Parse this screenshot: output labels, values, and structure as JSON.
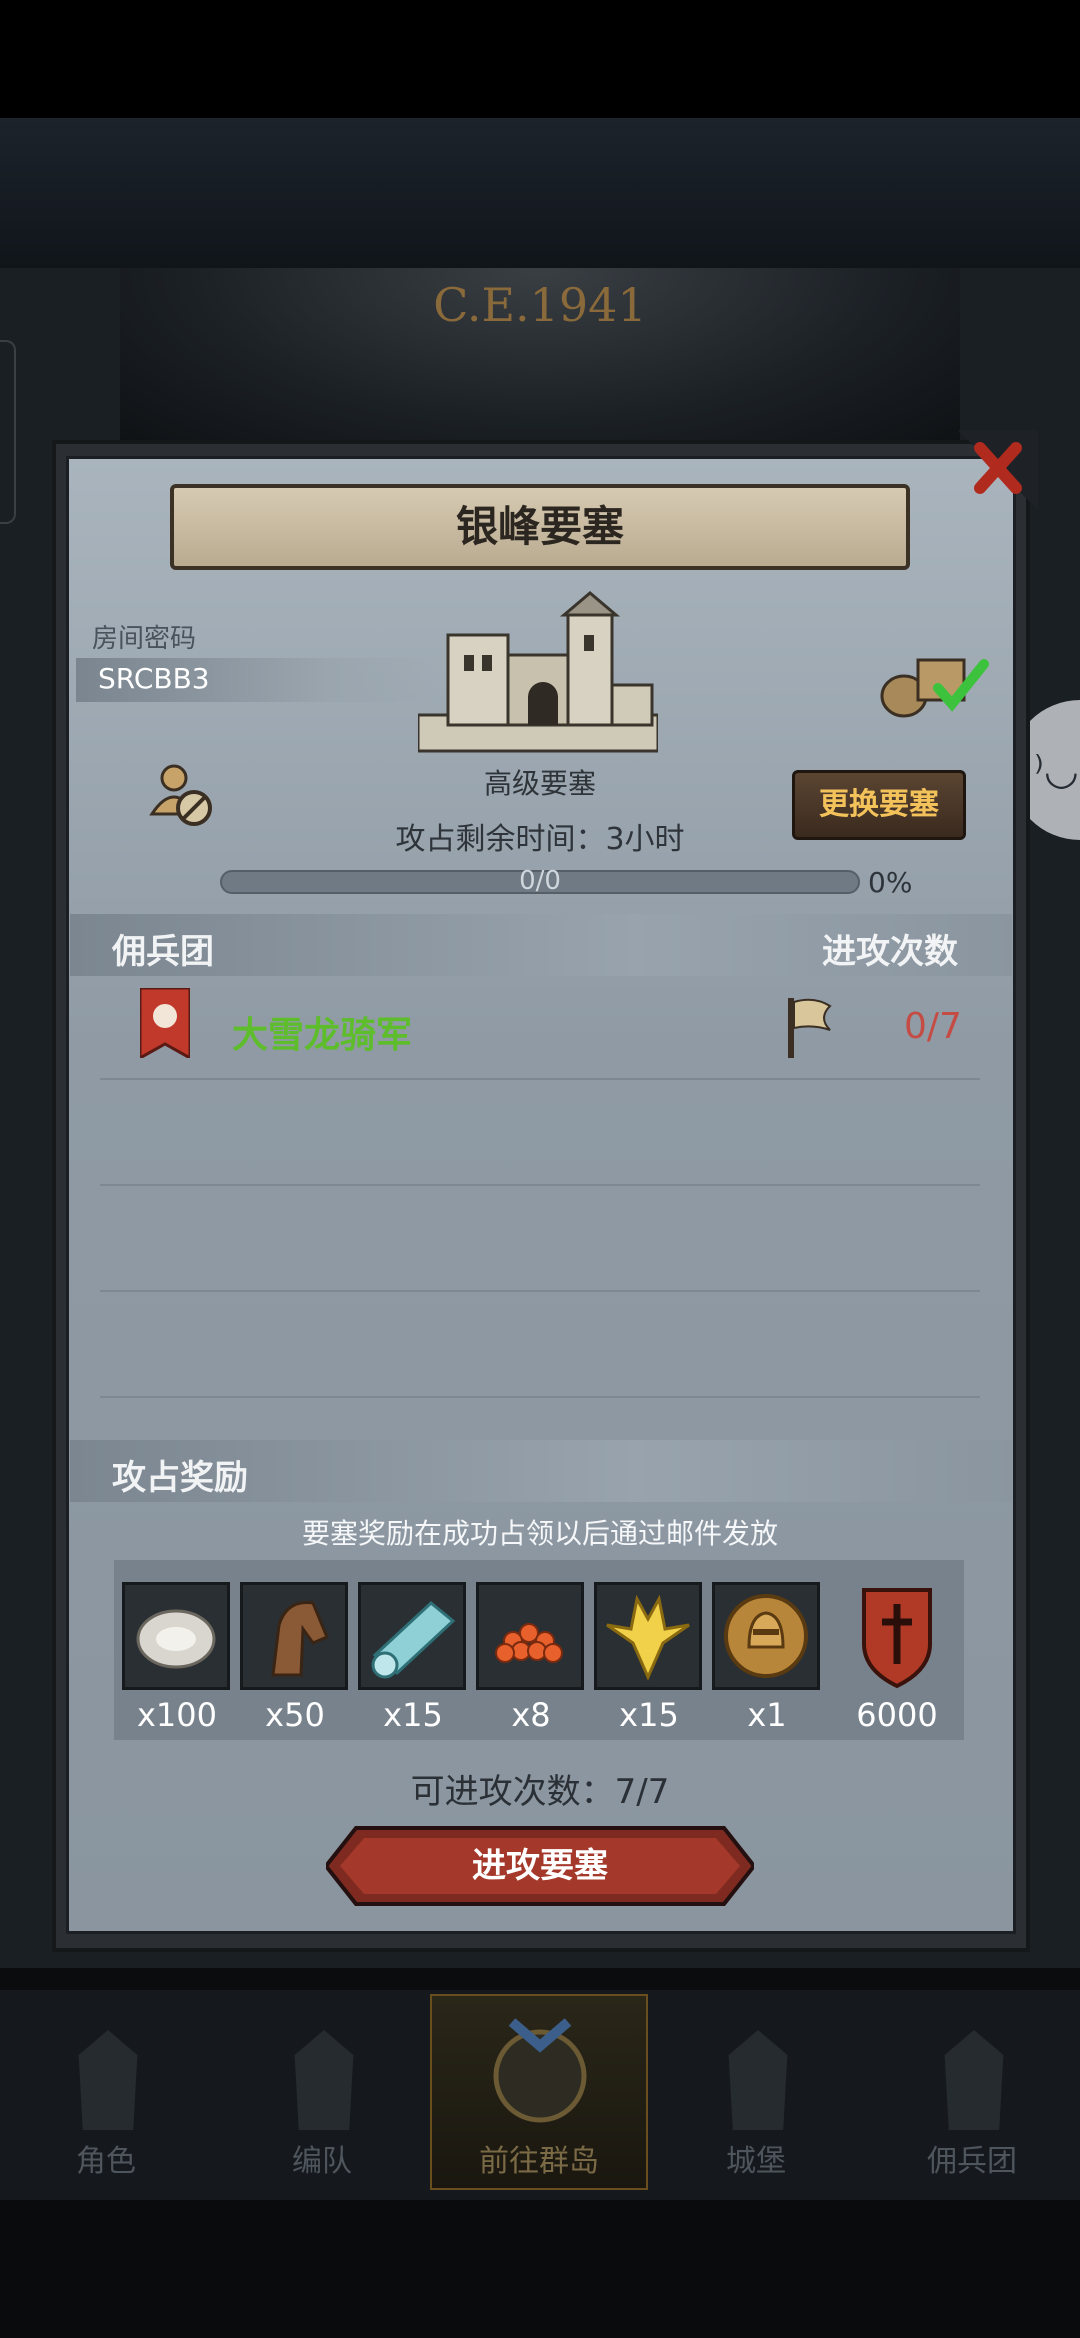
{
  "backdrop": {
    "era": "C.E.1941"
  },
  "dialog": {
    "title": "银峰要塞",
    "password_label": "房间密码",
    "password_value": "SRCBB3",
    "fortress_grade": "高级要塞",
    "swap_button": "更换要塞",
    "time_left": "攻占剩余时间：3小时",
    "progress_text": "0/0",
    "progress_pct": "0%",
    "progress_fraction": 0
  },
  "mercenary": {
    "header_left": "佣兵团",
    "header_right": "进攻次数",
    "rows": [
      {
        "name": "大雪龙骑军",
        "count": "0/7"
      }
    ]
  },
  "rewards": {
    "header": "攻占奖励",
    "note": "要塞奖励在成功占领以后通过邮件发放",
    "items": [
      {
        "icon": "oyster-icon",
        "qty": "x100"
      },
      {
        "icon": "horse-icon",
        "qty": "x50"
      },
      {
        "icon": "cloth-roll-icon",
        "qty": "x15"
      },
      {
        "icon": "roe-icon",
        "qty": "x8"
      },
      {
        "icon": "golden-crest-icon",
        "qty": "x15"
      },
      {
        "icon": "knight-medal-icon",
        "qty": "x1"
      },
      {
        "icon": "honor-shield-icon",
        "qty": "6000"
      }
    ]
  },
  "attack": {
    "count_text": "可进攻次数：7/7",
    "button": "进攻要塞"
  },
  "nav": {
    "items": [
      {
        "label": "角色"
      },
      {
        "label": "编队"
      },
      {
        "label": "前往群岛"
      },
      {
        "label": "城堡"
      },
      {
        "label": "佣兵团"
      }
    ]
  },
  "colors": {
    "guild_name": "#5dbd2b",
    "attack_count": "#c44c44",
    "swap_text": "#f3c25b"
  }
}
